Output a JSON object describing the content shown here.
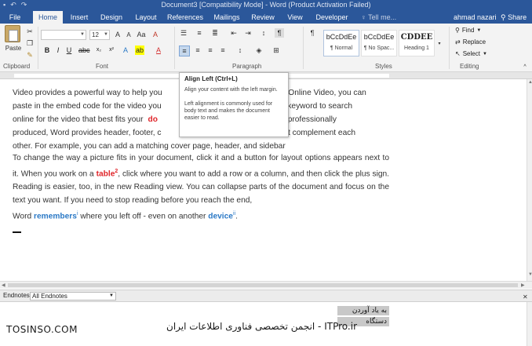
{
  "window": {
    "title": "Document3 [Compatibility Mode] - Word (Product Activation Failed)"
  },
  "tabs": [
    "File",
    "Home",
    "Insert",
    "Design",
    "Layout",
    "References",
    "Mailings",
    "Review",
    "View",
    "Developer"
  ],
  "active_tab": "Home",
  "tell_me": "Tell me...",
  "user": "ahmad nazari",
  "share": "Share",
  "ribbon": {
    "paste_label": "Paste",
    "font_size": "12",
    "groups": {
      "clipboard": "Clipboard",
      "font": "Font",
      "paragraph": "Paragraph",
      "styles": "Styles",
      "editing": "Editing"
    },
    "styles": [
      {
        "preview": "bCcDdEe",
        "name": "¶ Normal"
      },
      {
        "preview": "bCcDdEe",
        "name": "¶ No Spac..."
      },
      {
        "preview": "CDDEE",
        "name": "Heading 1"
      }
    ],
    "editing": {
      "find": "Find",
      "replace": "Replace",
      "select": "Select"
    }
  },
  "tooltip": {
    "title": "Align Left (Ctrl+L)",
    "description": "Align your content with the left margin.",
    "extra": "Left alignment is commonly used for body text and makes the document easier to read."
  },
  "document": {
    "p1_line1_a": "Video provides a powerful way to help you",
    "p1_line1_b": "click Online Video, you can",
    "p1_line2_a": "paste in the embed code for the video you",
    "p1_line2_b": "type a keyword to search",
    "p1_line3_a": "online for the video that best fits your",
    "p1_line3_hl": "do",
    "p1_line3_b": "cument look professionally",
    "p1_line4_a": "produced, Word provides header, footer, c",
    "p1_line4_b": "gns that complement each",
    "p1_line5": "other. For example, you can add a matching cover page, header, and sidebar",
    "p2_a": "To change the way a picture fits in your document, click it and a button for layout options appears next to it. When you work on a ",
    "p2_hl": "table",
    "p2_sup": "2",
    "p2_b": ", click where you want to add a row or a column, and then click the plus sign. Reading is easier, too, in the new Reading view. You can collapse parts of the document and focus on the text you want. If you need to stop reading before you reach the end,",
    "p3_a": "Word ",
    "p3_hl1": "remembers",
    "p3_sup1": "i",
    "p3_b": " where you left off - even on another ",
    "p3_hl2": "device",
    "p3_sup2": "ii",
    "p3_c": "."
  },
  "notes": {
    "label": "Endnotes",
    "select": "All Endnotes",
    "note1": "به یاد آوردن",
    "note2": "دستگاه"
  },
  "watermark": {
    "left": "TOSINSO.COM",
    "right": "ITPro.ir - انجمن تخصصی فناوری اطلاعات ایران"
  },
  "colors": {
    "accent": "#2b579a",
    "highlight_red": "#e0262b",
    "highlight_blue": "#2b79c6"
  }
}
